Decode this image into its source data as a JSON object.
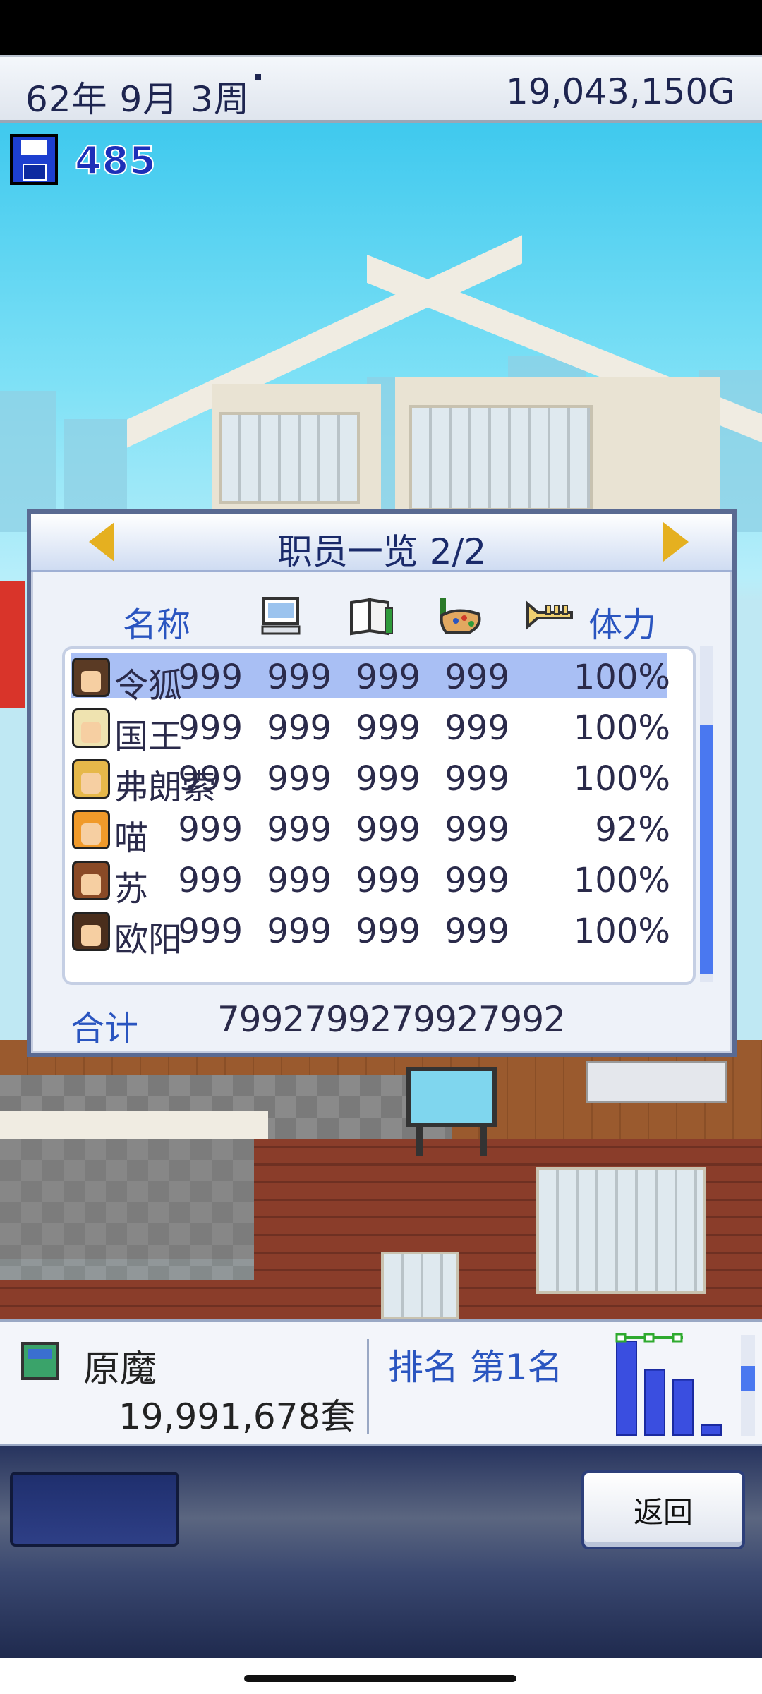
{
  "topbar": {
    "date": "62年 9月 3周",
    "money": "19,043,150G"
  },
  "save": {
    "count": "485"
  },
  "dialog": {
    "title": "职员一览 2/2",
    "headers": {
      "name": "名称",
      "stamina": "体力"
    },
    "header_icons": [
      "computer-icon",
      "book-icon",
      "paint-palette-icon",
      "trumpet-icon"
    ],
    "rows": [
      {
        "name": "令狐",
        "v1": "999",
        "v2": "999",
        "v3": "999",
        "v4": "999",
        "stamina": "100%",
        "avatar_color": "#5a3a24"
      },
      {
        "name": "国王",
        "v1": "999",
        "v2": "999",
        "v3": "999",
        "v4": "999",
        "stamina": "100%",
        "avatar_color": "#efe3b0"
      },
      {
        "name": "弗朗索",
        "v1": "999",
        "v2": "999",
        "v3": "999",
        "v4": "999",
        "stamina": "100%",
        "avatar_color": "#e6b84a"
      },
      {
        "name": "喵",
        "v1": "999",
        "v2": "999",
        "v3": "999",
        "v4": "999",
        "stamina": "92%",
        "avatar_color": "#f09a2a"
      },
      {
        "name": "苏",
        "v1": "999",
        "v2": "999",
        "v3": "999",
        "v4": "999",
        "stamina": "100%",
        "avatar_color": "#8a4a26"
      },
      {
        "name": "欧阳",
        "v1": "999",
        "v2": "999",
        "v3": "999",
        "v4": "999",
        "stamina": "100%",
        "avatar_color": "#4a2e1c"
      }
    ],
    "total_label": "合计",
    "total_values": "7992799279927992"
  },
  "bottom": {
    "product_name": "原魔",
    "product_sales": "19,991,678套",
    "rank": "排名 第1名",
    "sales_chart": [
      0.95,
      0.66,
      0.56,
      0.1
    ]
  },
  "nav": {
    "back_label": "返回"
  },
  "colors": {
    "accent": "#2a55c0",
    "selected_row": "#a9bff4",
    "arrow": "#e5b020"
  }
}
